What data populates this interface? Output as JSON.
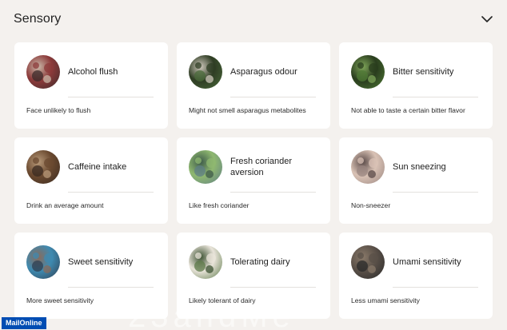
{
  "section": {
    "title": "Sensory"
  },
  "cards": [
    {
      "name": "Alcohol flush",
      "result": "Face unlikely to flush",
      "icon": "alcohol-photo",
      "colors": [
        "#3b2a2a",
        "#8c3a3a",
        "#c9b8a8"
      ]
    },
    {
      "name": "Asparagus odour",
      "result": "Might not smell asparagus metabolites",
      "icon": "asparagus-photo",
      "colors": [
        "#4a6a3a",
        "#2f3d24",
        "#cfc8bc"
      ]
    },
    {
      "name": "Bitter sensitivity",
      "result": "Not able to taste a certain bitter flavor",
      "icon": "brussels-sprouts-photo",
      "colors": [
        "#4f7a35",
        "#2a3d1e",
        "#7fa659"
      ]
    },
    {
      "name": "Caffeine intake",
      "result": "Drink an average amount",
      "icon": "coffee-beans-photo",
      "colors": [
        "#3a2a20",
        "#6b4a30",
        "#b89a7a"
      ]
    },
    {
      "name": "Fresh coriander aversion",
      "result": "Like fresh coriander",
      "icon": "coriander-photo",
      "colors": [
        "#5f7f86",
        "#8fb870",
        "#3d5a4a"
      ]
    },
    {
      "name": "Sun sneezing",
      "result": "Non-sneezer",
      "icon": "person-sneezing-photo",
      "colors": [
        "#9a8680",
        "#d9c2b5",
        "#5a4a48"
      ]
    },
    {
      "name": "Sweet sensitivity",
      "result": "More sweet sensitivity",
      "icon": "sweet-photo",
      "colors": [
        "#2f3f52",
        "#3f8ab0",
        "#8a6a5a"
      ]
    },
    {
      "name": "Tolerating dairy",
      "result": "Likely tolerant of dairy",
      "icon": "person-drinking-milk-photo",
      "colors": [
        "#5d7a4a",
        "#e9e4da",
        "#3a5030"
      ]
    },
    {
      "name": "Umami sensitivity",
      "result": "Less umami sensitivity",
      "icon": "umami-photo",
      "colors": [
        "#2a2a2a",
        "#5a5048",
        "#8a7a6a"
      ]
    }
  ],
  "footer": {
    "logo": "MailOnline"
  }
}
